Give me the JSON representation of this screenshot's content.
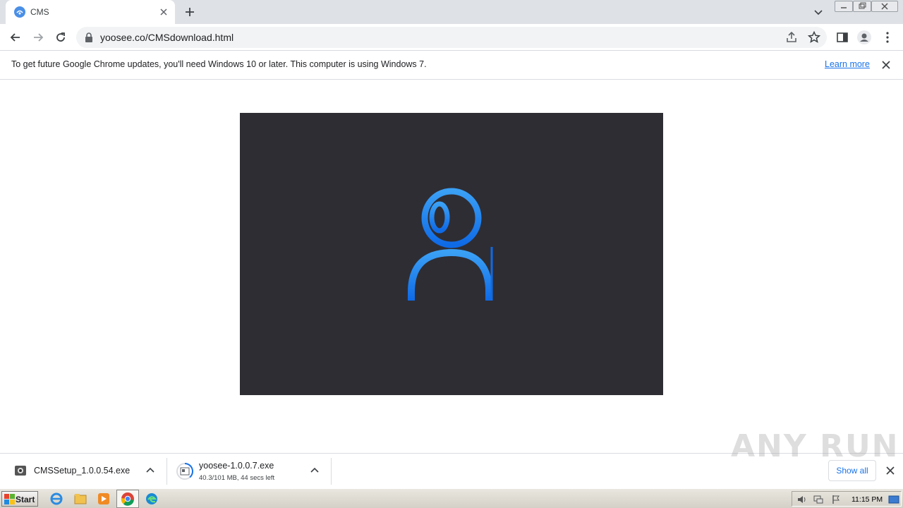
{
  "browser": {
    "tab": {
      "title": "CMS"
    },
    "address_bar": {
      "url": "yoosee.co/CMSdownload.html"
    }
  },
  "infobar": {
    "message": "To get future Google Chrome updates, you'll need Windows 10 or later. This computer is using Windows 7.",
    "link": "Learn more"
  },
  "page": {
    "hero_background": "#2e2d34",
    "logo_color": "#1e7ef0"
  },
  "downloads": {
    "items": [
      {
        "name": "CMSSetup_1.0.0.54.exe",
        "status": ""
      },
      {
        "name": "yoosee-1.0.0.7.exe",
        "status": "40.3/101 MB, 44 secs left"
      }
    ],
    "show_all": "Show all",
    "watermark": "ANY RUN"
  },
  "taskbar": {
    "start": "Start",
    "clock": "11:15 PM",
    "apps": [
      "internet-explorer-icon",
      "explorer-icon",
      "media-player-icon",
      "chrome-icon",
      "edge-icon"
    ]
  }
}
